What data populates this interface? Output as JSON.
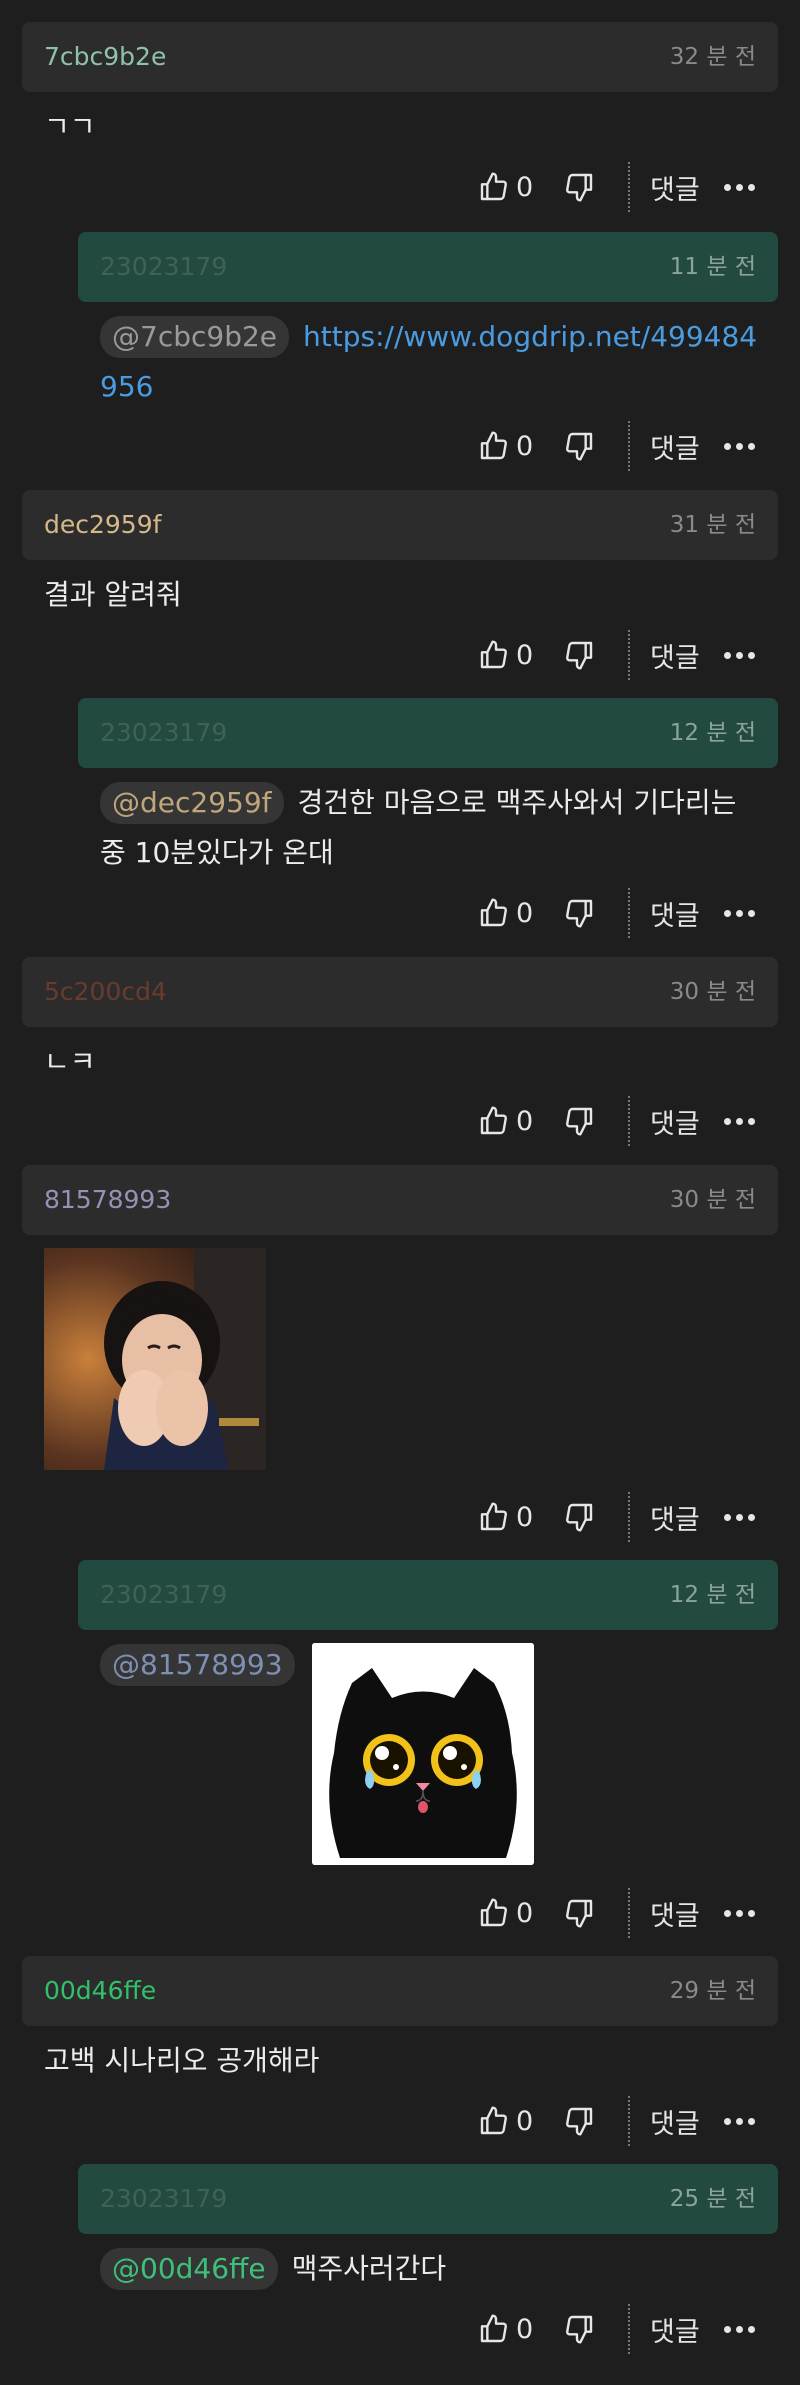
{
  "threads": [
    {
      "user": "7cbc9b2e",
      "user_color": "#8fc2a8",
      "time": "32 분 전",
      "text": "ㄱㄱ",
      "likes": "0",
      "reply_label": "댓글"
    },
    {
      "user": "23023179",
      "user_color": "#3f6157",
      "time": "11 분 전",
      "mention": "@7cbc9b2e",
      "mention_color": "#9a9a9a",
      "text_line1": "https://www.dogdrip.net/499484",
      "text_line2": "956",
      "likes": "0",
      "reply_label": "댓글"
    },
    {
      "user": "dec2959f",
      "user_color": "#d6b98a",
      "time": "31 분 전",
      "text": "결과 알려줘",
      "likes": "0",
      "reply_label": "댓글"
    },
    {
      "user": "23023179",
      "user_color": "#3f6157",
      "time": "12 분 전",
      "mention": "@dec2959f",
      "mention_color": "#bfa77b",
      "text_line1": "경건한 마음으로 맥주사와서 기다리는",
      "text_line2": "중 10분있다가 온대",
      "likes": "0",
      "reply_label": "댓글"
    },
    {
      "user": "5c200cd4",
      "user_color": "#6a3b2c",
      "time": "30 분 전",
      "text": "ㄴㅋ",
      "likes": "0",
      "reply_label": "댓글"
    },
    {
      "user": "81578993",
      "user_color": "#9a8fb4",
      "time": "30 분 전",
      "likes": "0",
      "reply_label": "댓글"
    },
    {
      "user": "23023179",
      "user_color": "#3f6157",
      "time": "12 분 전",
      "mention": "@81578993",
      "mention_color": "#7d8fb3",
      "likes": "0",
      "reply_label": "댓글"
    },
    {
      "user": "00d46ffe",
      "user_color": "#32c06a",
      "time": "29 분 전",
      "text": "고백 시나리오 공개해라",
      "likes": "0",
      "reply_label": "댓글"
    },
    {
      "user": "23023179",
      "user_color": "#3f6157",
      "time": "25 분 전",
      "mention": "@00d46ffe",
      "mention_color": "#3fbf7a",
      "text": "맥주사러간다",
      "likes": "0",
      "reply_label": "댓글"
    }
  ]
}
